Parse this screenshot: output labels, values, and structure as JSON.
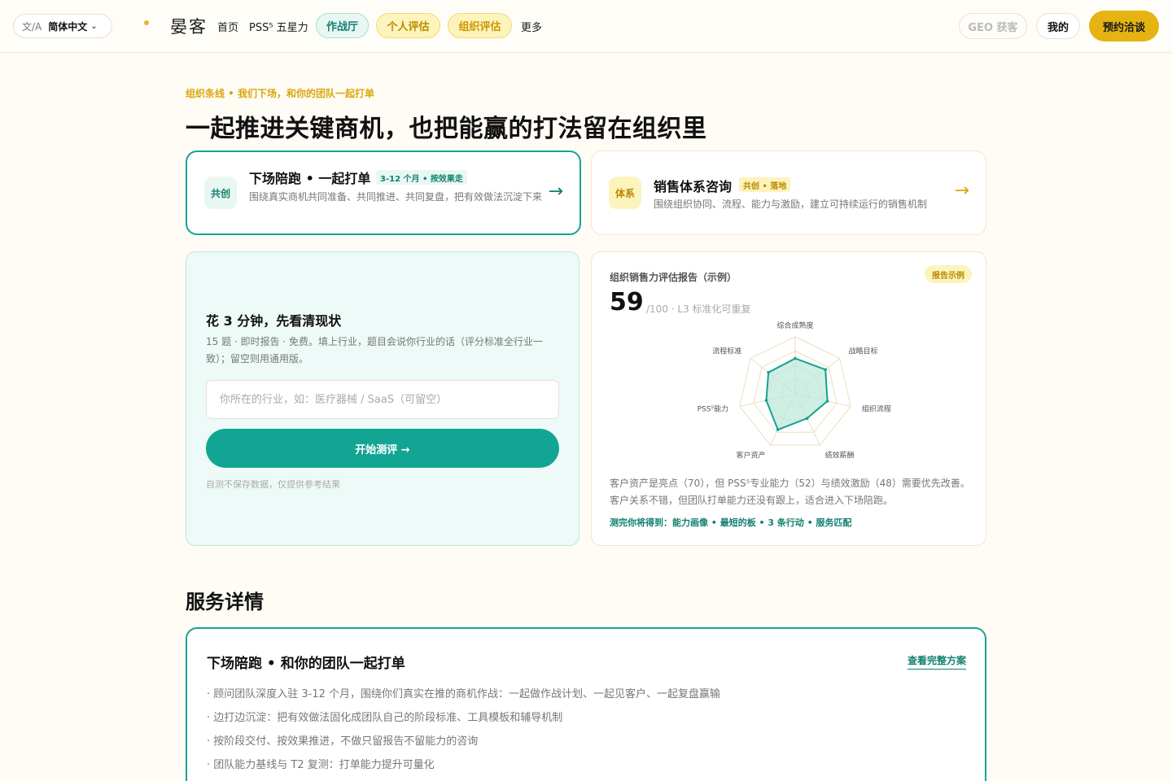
{
  "header": {
    "lang_icon": "文/A",
    "lang_current": "简体中文",
    "brand": "晏客",
    "nav": {
      "home": "首页",
      "pss": "PSS⁵ 五星力",
      "war_room": "作战厅",
      "personal_eval": "个人评估",
      "org_eval": "组织评估",
      "more": "更多"
    },
    "geo": "GEO 获客",
    "mine": "我的",
    "book": "预约洽谈"
  },
  "hero": {
    "eyebrow": "组织条线 • 我们下场，和你的团队一起打单",
    "title": "一起推进关键商机，也把能赢的打法留在组织里"
  },
  "offers": [
    {
      "badge": "共创",
      "title": "下场陪跑 • 一起打单",
      "tag": "3-12 个月 • 按效果走",
      "desc": "围绕真实商机共同准备、共同推进、共同复盘，把有效做法沉淀下来",
      "arrow": "→"
    },
    {
      "badge": "体系",
      "title": "销售体系咨询",
      "tag": "共创 • 落地",
      "desc": "围绕组织协同、流程、能力与激励，建立可持续运行的销售机制",
      "arrow": "→"
    }
  ],
  "quiz": {
    "title": "花 3 分钟，先看清现状",
    "desc": "15 题 · 即时报告 · 免费。填上行业，题目会说你行业的话（评分标准全行业一致）；留空则用通用版。",
    "input_placeholder": "你所在的行业，如：医疗器械 / SaaS（可留空）",
    "input_value": "",
    "button": "开始测评 →",
    "note": "自测不保存数据，仅提供参考结果"
  },
  "report": {
    "title": "组织销售力评估报告（示例）",
    "badge": "报告示例",
    "score": "59",
    "score_sub": "/100 · L3 标准化可重复",
    "summary": "客户资产是亮点（70），但 PSS⁵专业能力（52）与绩效激励（48）需要优先改善。客户关系不错，但团队打单能力还没有跟上，适合进入下场陪跑。",
    "footer": "测完你将得到：能力画像 • 最短的板 • 3 条行动 • 服务匹配",
    "radar": {
      "max": 100,
      "axes": [
        "综合成熟度",
        "战略目标",
        "组织流程",
        "绩效薪酬",
        "客户资产",
        "PSS⁵能力",
        "流程标准"
      ],
      "values": [
        62,
        68,
        58,
        48,
        70,
        52,
        60
      ],
      "colors": {
        "stroke": "#14a390",
        "fill": "#bfe8db",
        "grid": "#eadfbf"
      }
    }
  },
  "services": {
    "section_title": "服务详情",
    "card_title": "下场陪跑 • 和你的团队一起打单",
    "link": "查看完整方案",
    "items": [
      "· 顾问团队深度入驻 3-12 个月，围绕你们真实在推的商机作战：一起做作战计划、一起见客户、一起复盘赢输",
      "· 边打边沉淀：把有效做法固化成团队自己的阶段标准、工具模板和辅导机制",
      "· 按阶段交付、按效果推进，不做只留报告不留能力的咨询",
      "· 团队能力基线与 T2 复测：打单能力提升可量化"
    ]
  }
}
